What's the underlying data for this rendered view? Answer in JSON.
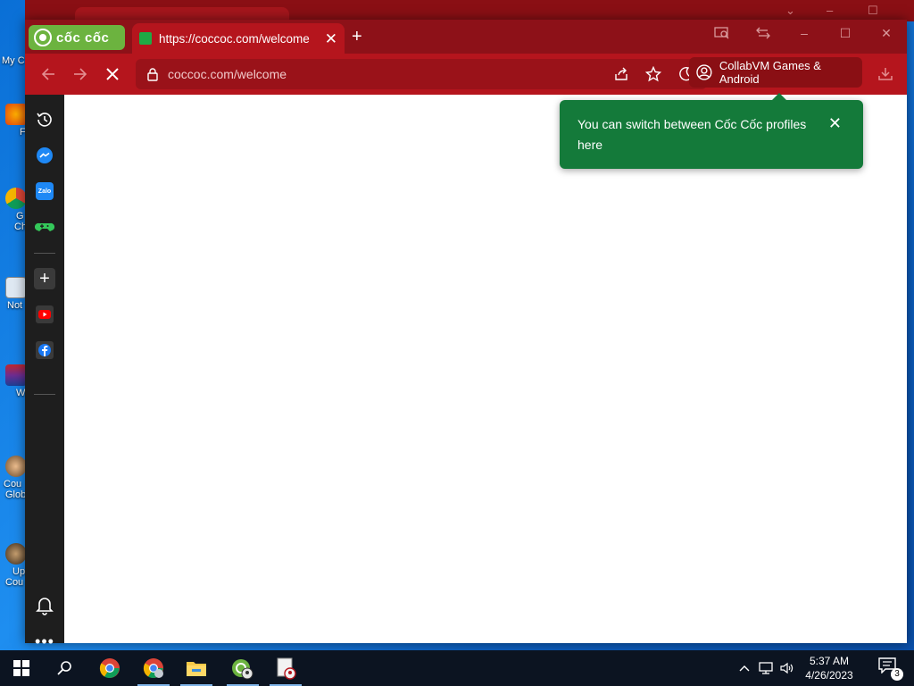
{
  "desktop": {
    "icons": [
      {
        "label": "My C"
      },
      {
        "label": "F"
      },
      {
        "label": "G"
      },
      {
        "label": "Ch"
      },
      {
        "label": "Not"
      },
      {
        "label": "W"
      },
      {
        "label": "Cou"
      },
      {
        "label": "Glob"
      },
      {
        "label": "Up"
      },
      {
        "label": "Cou"
      }
    ]
  },
  "browser": {
    "brand": "cốc cốc",
    "tab": {
      "title": "https://coccoc.com/welcome",
      "favicon_color": "#1faa45"
    },
    "omnibox": {
      "url": "coccoc.com/welcome"
    },
    "profile_button": {
      "label": "CollabVM Games & Android"
    },
    "tooltip": {
      "text": "You can switch between Cốc Cốc profiles here"
    },
    "colors": {
      "frame": "#8d1118",
      "toolbar": "#b5151d",
      "tooltip": "#147a3a",
      "sidebar": "#1e1e1e"
    }
  },
  "sidebar": {
    "items": [
      "history-icon",
      "messenger-icon",
      "zalo-icon",
      "games-icon",
      "add-icon",
      "youtube-icon",
      "facebook-icon",
      "bell-icon",
      "more-icon"
    ],
    "zalo_label": "Zalo"
  },
  "taskbar": {
    "time": "5:37 AM",
    "date": "4/26/2023",
    "notification_count": "3"
  }
}
